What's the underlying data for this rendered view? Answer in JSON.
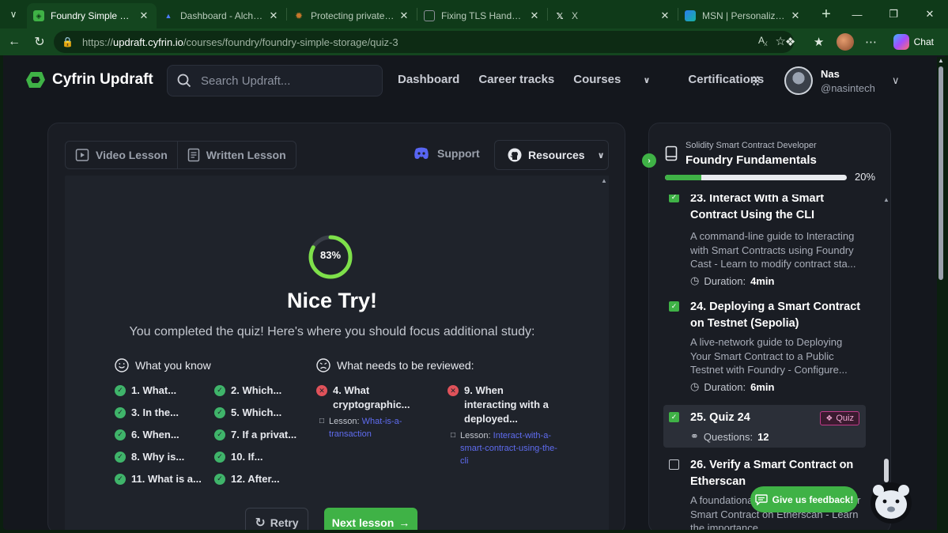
{
  "browser": {
    "tabs": [
      {
        "title": "Foundry Simple Storage",
        "active": true,
        "favicon": "cyfrin-icon",
        "color": "#3fb246"
      },
      {
        "title": "Dashboard - Alchemy",
        "active": false,
        "favicon": "alchemy-icon",
        "color": "#3d6bff"
      },
      {
        "title": "Protecting private keys w",
        "active": false,
        "favicon": "sun-icon",
        "color": "#c7772b"
      },
      {
        "title": "Fixing TLS Handshake E",
        "active": false,
        "favicon": "browser-icon",
        "color": "#8a8f98"
      },
      {
        "title": "X",
        "active": false,
        "favicon": "x-icon",
        "color": "#ffffff"
      },
      {
        "title": "MSN | Personalized New",
        "active": false,
        "favicon": "msn-icon",
        "color": "#2a7df0"
      }
    ],
    "url_prefix": "https://",
    "url_host": "updraft.cyfrin.io",
    "url_path": "/courses/foundry/foundry-simple-storage/quiz-3",
    "chat_label": "Chat"
  },
  "site": {
    "brand": "Cyfrin Updraft",
    "search_placeholder": "Search Updraft...",
    "nav": [
      "Dashboard",
      "Career tracks",
      "Courses",
      "Certifications"
    ],
    "user_name": "Nas",
    "user_handle": "@nasintech"
  },
  "lesson": {
    "tabs": [
      "Video Lesson",
      "Written Lesson"
    ],
    "support_label": "Support",
    "resources_label": "Resources"
  },
  "quiz": {
    "score_percent": 83,
    "score_label": "83%",
    "headline": "Nice Try!",
    "subline": "You completed the quiz! Here's where you should focus additional study:",
    "known_heading": "What you know",
    "review_heading": "What needs to be reviewed:",
    "known_items": [
      "1. What...",
      "2. Which...",
      "3. In the...",
      "5. Which...",
      "6. When...",
      "7. If a privat...",
      "8. Why is...",
      "10. If...",
      "11. What is a...",
      "12. After..."
    ],
    "review_items": [
      {
        "title": "4. What cryptographic...",
        "lesson_prefix": "Lesson:",
        "lesson_link": "What-is-a-transaction"
      },
      {
        "title": "9. When interacting with a deployed...",
        "lesson_prefix": "Lesson:",
        "lesson_link": "Interact-with-a-smart-contract-using-the-cli"
      }
    ],
    "retry_label": "Retry",
    "next_label": "Next lesson"
  },
  "sidebar": {
    "track": "Solidity Smart Contract Developer",
    "course": "Foundry Fundamentals",
    "progress_percent": 20,
    "progress_label": "20%",
    "lessons": [
      {
        "title": "23. Interact With a Smart Contract Using the CLI",
        "desc": "A command-line guide to Interacting with Smart Contracts using Foundry Cast - Learn to modify contract sta...",
        "meta_label": "Duration:",
        "meta_value": "4min",
        "done": true
      },
      {
        "title": "24. Deploying a Smart Contract on Testnet (Sepolia)",
        "desc": "A live-network guide to Deploying Your Smart Contract to a Public Testnet with Foundry - Configure...",
        "meta_label": "Duration:",
        "meta_value": "6min",
        "done": true
      },
      {
        "title": "25. Quiz 24",
        "badge": "Quiz",
        "meta_label": "Questions:",
        "meta_value": "12",
        "done": true,
        "active": true
      },
      {
        "title": "26. Verify a Smart Contract on Etherscan",
        "desc": "A foundational guide to Verifying Your Smart Contract on Etherscan - Learn the importance ...",
        "done": false
      }
    ]
  },
  "feedback_label": "Give us feedback!",
  "colors": {
    "accent": "#3fb246",
    "error": "#e0525a",
    "link": "#5f6cf0"
  }
}
